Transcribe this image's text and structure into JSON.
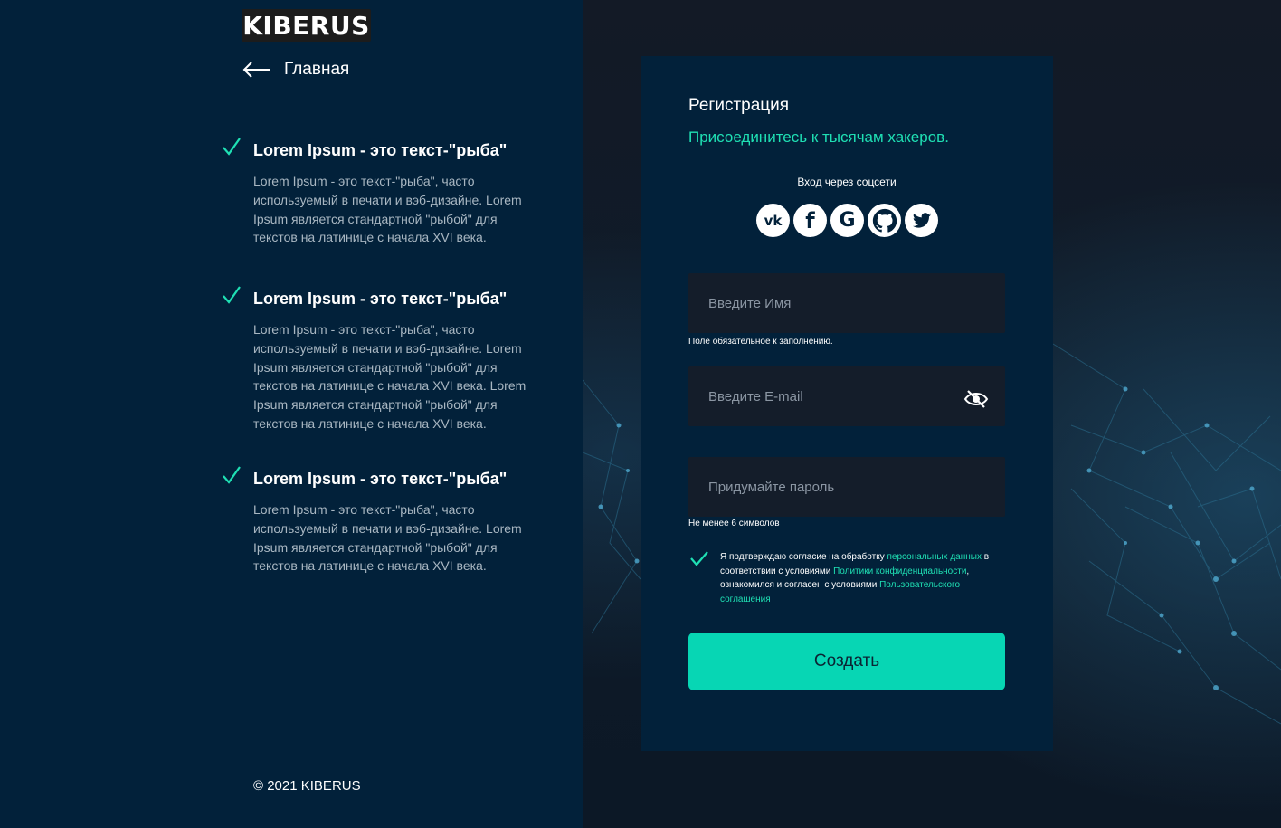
{
  "brand": {
    "logo_text": "KIBERUS"
  },
  "nav": {
    "back_label": "Главная"
  },
  "features": [
    {
      "title": "Lorem Ipsum - это текст-\"рыба\"",
      "description": "Lorem Ipsum - это текст-\"рыба\", часто используемый в печати и вэб-дизайне. Lorem Ipsum является стандартной \"рыбой\" для текстов на латинице с начала XVI века."
    },
    {
      "title": "Lorem Ipsum - это текст-\"рыба\"",
      "description": "Lorem Ipsum - это текст-\"рыба\", часто используемый в печати и вэб-дизайне. Lorem Ipsum является стандартной \"рыбой\" для текстов на латинице с начала XVI века.  Lorem Ipsum является стандартной \"рыбой\" для текстов на латинице с начала XVI века."
    },
    {
      "title": "Lorem Ipsum - это текст-\"рыба\"",
      "description": "Lorem Ipsum - это текст-\"рыба\", часто используемый в печати и вэб-дизайне. Lorem Ipsum является стандартной \"рыбой\" для текстов на латинице с начала XVI века."
    }
  ],
  "footer": {
    "copyright": "© 2021 KIBERUS"
  },
  "form": {
    "title": "Регистрация",
    "subtitle": "Присоединитесь к тысячам хакеров.",
    "social_label": "Вход через соцсети",
    "social": [
      {
        "icon": "vk-icon",
        "glyph": "vk"
      },
      {
        "icon": "facebook-icon",
        "glyph": "f"
      },
      {
        "icon": "google-icon",
        "glyph": "G"
      },
      {
        "icon": "github-icon",
        "glyph": ""
      },
      {
        "icon": "twitter-icon",
        "glyph": ""
      }
    ],
    "name": {
      "placeholder": "Введите Имя",
      "value": "",
      "hint": "Поле обязательное к заполнению."
    },
    "email": {
      "placeholder": "Введите E-mail",
      "value": ""
    },
    "password": {
      "placeholder": "Придумайте пароль",
      "value": "",
      "hint": "Не менее 6 символов"
    },
    "consent": {
      "checked": true,
      "text_1": "Я подтверждаю согласие на обработку ",
      "link_1": "персональных данных",
      "text_2": " в соответствии с условиями ",
      "link_2": "Политики конфиденциальности",
      "text_3": ", ознакомился и согласен с условиями ",
      "link_3": "Пользовательского соглашения"
    },
    "submit_label": "Создать"
  },
  "colors": {
    "accent": "#1fe0b4",
    "button": "#07d6b4",
    "panel": "#02213a",
    "field": "#141d2a"
  }
}
